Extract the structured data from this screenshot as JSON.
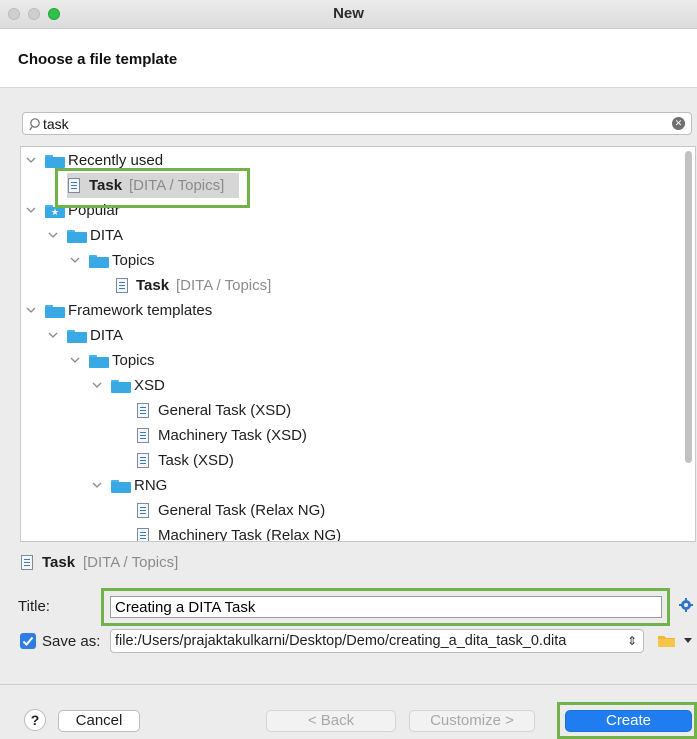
{
  "window": {
    "title": "New"
  },
  "header": {
    "title": "Choose a file template"
  },
  "search": {
    "value": "task"
  },
  "tree": {
    "recently_used": {
      "label": "Recently used",
      "task_name": "Task",
      "task_path": "[DITA / Topics]"
    },
    "popular": {
      "label": "Popular",
      "dita": "DITA",
      "topics": "Topics",
      "task_name": "Task",
      "task_path": "[DITA / Topics]"
    },
    "framework": {
      "label": "Framework templates",
      "dita": "DITA",
      "topics": "Topics",
      "xsd": {
        "label": "XSD",
        "items": [
          "General Task (XSD)",
          "Machinery Task (XSD)",
          "Task (XSD)"
        ]
      },
      "rng": {
        "label": "RNG",
        "items": [
          "General Task (Relax NG)",
          "Machinery Task (Relax NG)"
        ]
      }
    }
  },
  "summary": {
    "name": "Task",
    "path": "[DITA / Topics]"
  },
  "form": {
    "title_label": "Title:",
    "title_value": "Creating a DITA Task",
    "save_as_label": "Save as:",
    "save_as_value": "file:/Users/prajaktakulkarni/Desktop/Demo/creating_a_dita_task_0.dita",
    "save_as_checked": true
  },
  "buttons": {
    "help": "?",
    "cancel": "Cancel",
    "back": "< Back",
    "customize": "Customize >",
    "create": "Create"
  },
  "colors": {
    "accent": "#1f7df0",
    "highlight": "#71b34a",
    "folder": "#38a9e4"
  }
}
